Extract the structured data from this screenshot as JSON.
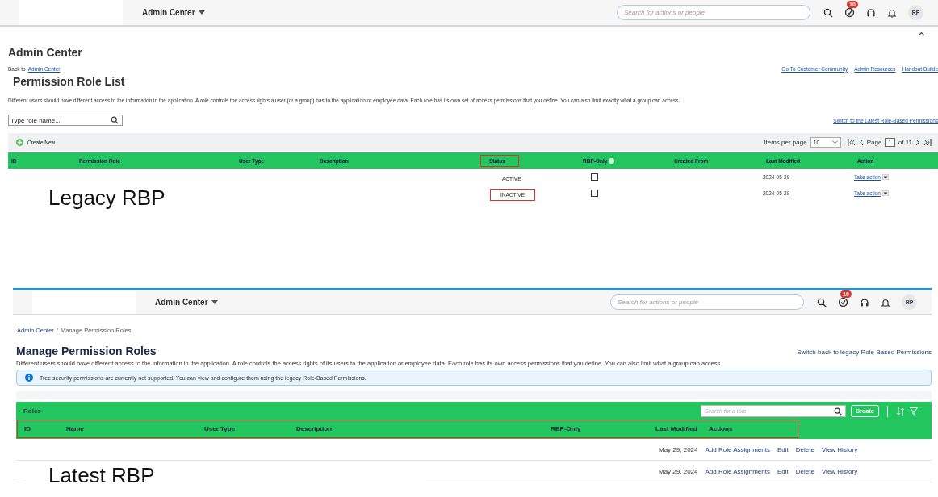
{
  "legacy": {
    "header": {
      "menu_title": "Admin Center",
      "search_placeholder": "Search for actions or people",
      "notification_count": "10",
      "avatar": "RP"
    },
    "page_title": "Admin Center",
    "back_text": "Back to",
    "back_link": "Admin Center",
    "links": [
      "Go To Customer Community",
      "Admin Resources",
      "Handout Builde"
    ],
    "heading": "Permission Role List",
    "description": "Different users should have different access to the information in the application. A *role* controls the access rights a user (or a group) has to the application or employee data. Each role has its own set of access permissions that you define. You can also limit exactly what a group can access.",
    "search_placeholder": "Type role name...",
    "switch_link": "Switch to the Latest Role-Based Permissions",
    "create_label": "Create New",
    "items_per_page_label": "Items per page",
    "items_per_page": "10",
    "page_label": "Page",
    "page": "1",
    "page_total": "of 11",
    "columns": [
      {
        "label": "ID",
        "highlighted": false
      },
      {
        "label": "Permission Role",
        "highlighted": false
      },
      {
        "label": "User Type",
        "highlighted": false
      },
      {
        "label": "Description",
        "highlighted": false
      },
      {
        "label": "Status",
        "highlighted": true
      },
      {
        "label": "RBP-Only",
        "highlighted": false
      },
      {
        "label": "Created From",
        "highlighted": false
      },
      {
        "label": "Last Modified",
        "highlighted": false
      },
      {
        "label": "Action",
        "highlighted": false
      }
    ],
    "rows": [
      {
        "status": "ACTIVE",
        "status_highlighted": false,
        "rbp_only": false,
        "last_modified": "2024-05-29",
        "action": "Take action"
      },
      {
        "status": "INACTIVE",
        "status_highlighted": true,
        "rbp_only": false,
        "last_modified": "2024-05-29",
        "action": "Take action"
      }
    ],
    "caption": "Legacy RBP"
  },
  "latest": {
    "header": {
      "menu_title": "Admin Center",
      "search_placeholder": "Search for actions or people",
      "notification_count": "10",
      "avatar": "RP"
    },
    "breadcrumb": [
      "Admin Center",
      "/",
      "Manage Permission Roles"
    ],
    "heading": "Manage Permission Roles",
    "switch_link": "Switch back to legacy Role-Based Permissions",
    "description": "Different users should have different access to the information in the application. A role controls the access rights of its users to the application or employee data. Each role has its own access permissions that you define. You can also limit what a group can access.",
    "info": "Tree security permissions are currently not supported. You can view and configure them using the legacy Role-Based Permissions.",
    "table_title": "Roles",
    "search_placeholder": "Search for a role",
    "create_label": "Create",
    "header_highlighted": true,
    "columns": [
      "ID",
      "Name",
      "User Type",
      "Description",
      "RBP-Only",
      "Last Modified",
      "Actions"
    ],
    "rows": [
      {
        "last_modified": "May 29, 2024",
        "actions": [
          "Add Role Assignments",
          "Edit",
          "Delete",
          "View History"
        ]
      },
      {
        "last_modified": "May 29, 2024",
        "actions": [
          "Add Role Assignments",
          "Edit",
          "Delete",
          "View History"
        ]
      }
    ],
    "caption": "Latest RBP"
  }
}
